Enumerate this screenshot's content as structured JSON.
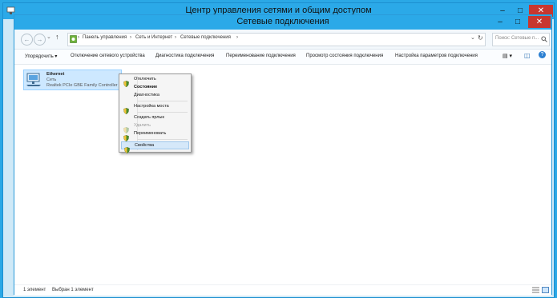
{
  "bg_window": {
    "title": "Центр управления сетями и общим доступом",
    "controls": {
      "minimize": "–",
      "maximize": "□",
      "close": "✕"
    }
  },
  "main_window": {
    "title": "Сетевые подключения",
    "controls": {
      "minimize": "–",
      "maximize": "□",
      "close": "✕"
    }
  },
  "nav": {
    "back": "←",
    "forward": "→",
    "recent": "⌄",
    "up": "↑"
  },
  "breadcrumb": [
    "Панель управления",
    "Сеть и Интернет",
    "Сетевые подключения"
  ],
  "breadcrumb_separator": "›",
  "address_dropdown": "⌄",
  "refresh": "↻",
  "search": {
    "placeholder": "Поиск: Сетевые п..."
  },
  "toolbar": {
    "organize": "Упорядочить ▾",
    "items": [
      "Отключение сетевого устройства",
      "Диагностика подключения",
      "Переименование подключения",
      "Просмотр состояния подключения",
      "Настройка параметров подключения"
    ],
    "view_icon": "▤ ▾",
    "pane_icon": "◫",
    "help_icon": "?"
  },
  "connection": {
    "name": "Ethernet",
    "network": "Сеть",
    "adapter": "Realtek PCIe GBE Family Controller"
  },
  "context_menu": {
    "items": [
      {
        "label": "Отключить",
        "shield": true,
        "state": "normal"
      },
      {
        "label": "Состояние",
        "shield": false,
        "state": "bold"
      },
      {
        "label": "Диагностика",
        "shield": false,
        "state": "normal"
      },
      {
        "label": "Настройка моста",
        "shield": true,
        "state": "normal"
      },
      {
        "label": "Создать ярлык",
        "shield": false,
        "state": "normal"
      },
      {
        "label": "Удалить",
        "shield": true,
        "state": "disabled"
      },
      {
        "label": "Переименовать",
        "shield": true,
        "state": "normal"
      },
      {
        "label": "Свойства",
        "shield": true,
        "state": "highlighted"
      }
    ]
  },
  "status": {
    "count": "1 элемент",
    "selected": "Выбран 1 элемент"
  },
  "colors": {
    "titlebar": "#2ba9e8",
    "close": "#c7372f",
    "selection": "#cde8ff"
  }
}
